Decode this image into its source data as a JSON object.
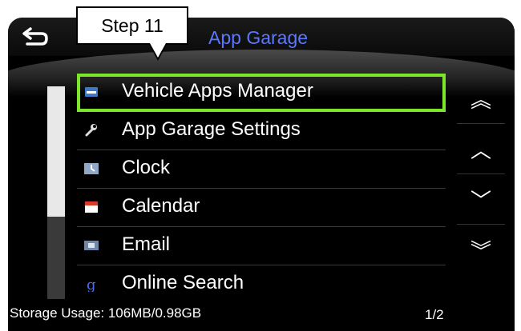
{
  "header": {
    "title": "App Garage",
    "back_icon": "back-arrow-icon"
  },
  "callout": {
    "label": "Step 11"
  },
  "list": {
    "items": [
      {
        "label": "Vehicle Apps Manager",
        "icon": "vehicle-apps-manager-icon",
        "selected": true
      },
      {
        "label": "App Garage Settings",
        "icon": "wrench-icon",
        "selected": false
      },
      {
        "label": "Clock",
        "icon": "clock-icon",
        "selected": false
      },
      {
        "label": "Calendar",
        "icon": "calendar-icon",
        "selected": false
      },
      {
        "label": "Email",
        "icon": "email-icon",
        "selected": false
      },
      {
        "label": "Online Search",
        "icon": "search-g-icon",
        "selected": false
      }
    ]
  },
  "side_buttons": [
    {
      "glyph": "︽",
      "icon": "page-up-icon"
    },
    {
      "glyph": "︿",
      "icon": "scroll-up-icon"
    },
    {
      "glyph": "﹀",
      "icon": "scroll-down-icon"
    },
    {
      "glyph": "︾",
      "icon": "page-down-icon"
    }
  ],
  "footer": {
    "storage": "Storage Usage: 106MB/0.98GB",
    "page": "1/2"
  },
  "colors": {
    "highlight": "#7ee62a",
    "title": "#5a78ff"
  }
}
